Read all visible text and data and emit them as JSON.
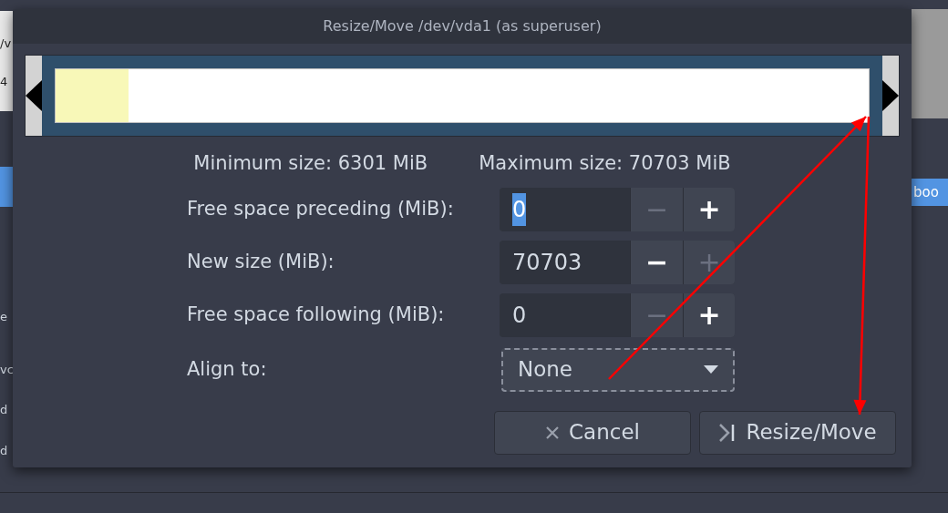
{
  "background_window": {
    "fragments": [
      {
        "text": "/v"
      },
      {
        "text": "4"
      },
      {
        "text": "e"
      },
      {
        "text": "vc"
      },
      {
        "text": "d"
      },
      {
        "text": "d"
      }
    ],
    "right_fragments": [
      {
        "text": "boo"
      }
    ]
  },
  "dialog": {
    "title": "Resize/Move /dev/vda1 (as superuser)",
    "partition_bar": {
      "level": 0.09
    },
    "minimum_size": "Minimum size: 6301 MiB",
    "maximum_size": "Maximum size: 70703 MiB",
    "fields": [
      {
        "label": "Free space preceding (MiB):",
        "value": "0",
        "value_selected": true,
        "minus": "−",
        "plus": "+",
        "minus_disabled": true,
        "plus_disabled": false
      },
      {
        "label": "New size (MiB):",
        "value": "70703",
        "value_selected": false,
        "minus": "−",
        "plus": "+",
        "minus_disabled": false,
        "plus_disabled": true
      },
      {
        "label": "Free space following (MiB):",
        "value": "0",
        "value_selected": false,
        "minus": "−",
        "plus": "+",
        "minus_disabled": true,
        "plus_disabled": false
      }
    ],
    "align": {
      "label": "Align to:",
      "value": "None",
      "focused": true
    },
    "buttons": [
      {
        "label": "Cancel",
        "kind": "cancel"
      },
      {
        "label": "Resize/Move",
        "kind": "apply"
      }
    ]
  }
}
